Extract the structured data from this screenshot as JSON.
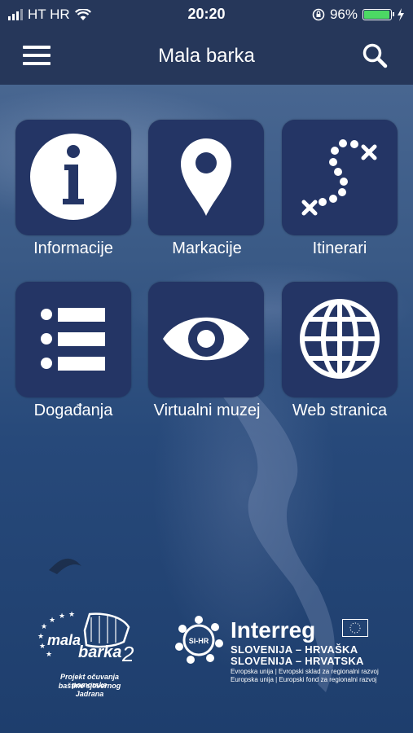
{
  "status_bar": {
    "carrier": "HT HR",
    "time": "20:20",
    "battery_percent": "96%",
    "battery_level": 0.96,
    "icons": [
      "signal-icon",
      "wifi-icon",
      "rotation-lock-icon",
      "battery-icon",
      "charging-icon"
    ]
  },
  "nav": {
    "title": "Mala barka",
    "menu_icon": "hamburger-menu-icon",
    "search_icon": "search-icon"
  },
  "tiles": [
    {
      "label": "Informacije",
      "icon": "info-icon"
    },
    {
      "label": "Markacije",
      "icon": "map-pin-icon"
    },
    {
      "label": "Itinerari",
      "icon": "itinerary-path-icon"
    },
    {
      "label": "Događanja",
      "icon": "list-icon"
    },
    {
      "label": "Virtualni muzej",
      "icon": "eye-icon"
    },
    {
      "label": "Web stranica",
      "icon": "globe-icon"
    }
  ],
  "footer": {
    "mala_barka_logo": {
      "word1": "mala",
      "word2": "barka",
      "number": "2",
      "tagline_line1": "Projekt očuvanja pomorske",
      "tagline_line2": "baštine sjevernog Jadrana"
    },
    "interreg_logo": {
      "badge": "SI-HR",
      "title": "Interreg",
      "line1": "SLOVENIJA – HRVAŠKA",
      "line2": "SLOVENIJA – HRVATSKA",
      "small1": "Evropska unija  |  Evropski sklad za regionalni razvoj",
      "small2": "Europska unija  |  Europski fond za regionalni razvoj"
    }
  },
  "colors": {
    "bar": "#26375a",
    "tile": "#243565",
    "battery": "#4cd964"
  }
}
